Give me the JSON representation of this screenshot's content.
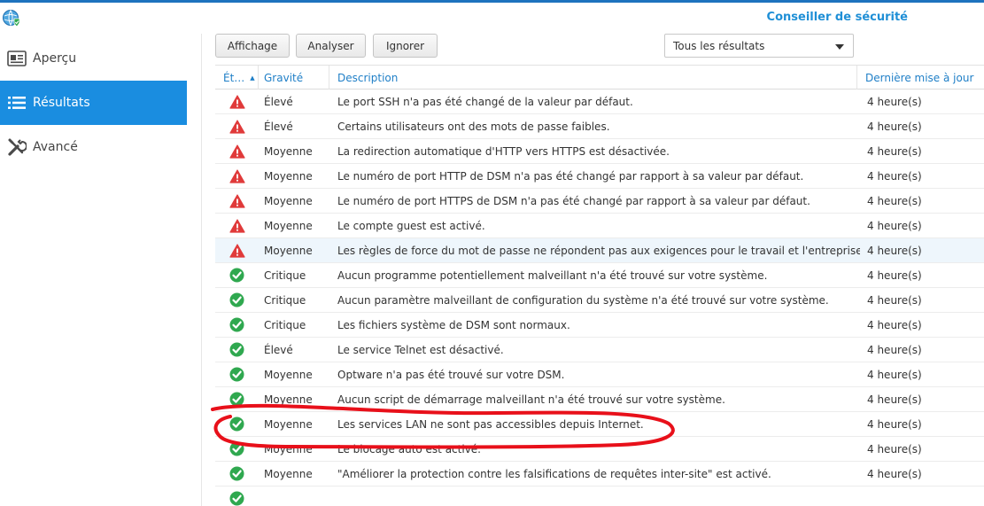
{
  "app": {
    "title": "Conseiller de sécurité",
    "icon": "security-globe-icon"
  },
  "sidebar": {
    "items": [
      {
        "label": "Aperçu",
        "icon": "overview-card-icon",
        "active": false
      },
      {
        "label": "Résultats",
        "icon": "list-icon",
        "active": true
      },
      {
        "label": "Avancé",
        "icon": "tools-icon",
        "active": false
      }
    ]
  },
  "toolbar": {
    "view_label": "Affichage",
    "analyze_label": "Analyser",
    "ignore_label": "Ignorer",
    "filter": {
      "selected": "Tous les résultats"
    }
  },
  "table": {
    "headers": {
      "status": "Ét…",
      "severity": "Gravité",
      "description": "Description",
      "updated": "Dernière mise à jour"
    },
    "rows": [
      {
        "status": "warning",
        "severity": "Élevé",
        "description": "Le port SSH n'a pas été changé de la valeur par défaut.",
        "updated": "4 heure(s)"
      },
      {
        "status": "warning",
        "severity": "Élevé",
        "description": "Certains utilisateurs ont des mots de passe faibles.",
        "updated": "4 heure(s)"
      },
      {
        "status": "warning",
        "severity": "Moyenne",
        "description": "La redirection automatique d'HTTP vers HTTPS est désactivée.",
        "updated": "4 heure(s)"
      },
      {
        "status": "warning",
        "severity": "Moyenne",
        "description": "Le numéro de port HTTP de DSM n'a pas été changé par rapport à sa valeur par défaut.",
        "updated": "4 heure(s)"
      },
      {
        "status": "warning",
        "severity": "Moyenne",
        "description": "Le numéro de port HTTPS de DSM n'a pas été changé par rapport à sa valeur par défaut.",
        "updated": "4 heure(s)"
      },
      {
        "status": "warning",
        "severity": "Moyenne",
        "description": "Le compte guest est activé.",
        "updated": "4 heure(s)"
      },
      {
        "status": "warning",
        "severity": "Moyenne",
        "description": "Les règles de force du mot de passe ne répondent pas aux exigences pour le travail et l'entreprise.",
        "updated": "4 heure(s)",
        "selected": true
      },
      {
        "status": "ok",
        "severity": "Critique",
        "description": "Aucun programme potentiellement malveillant n'a été trouvé sur votre système.",
        "updated": "4 heure(s)"
      },
      {
        "status": "ok",
        "severity": "Critique",
        "description": "Aucun paramètre malveillant de configuration du système n'a été trouvé sur votre système.",
        "updated": "4 heure(s)"
      },
      {
        "status": "ok",
        "severity": "Critique",
        "description": "Les fichiers système de DSM sont normaux.",
        "updated": "4 heure(s)"
      },
      {
        "status": "ok",
        "severity": "Élevé",
        "description": "Le service Telnet est désactivé.",
        "updated": "4 heure(s)"
      },
      {
        "status": "ok",
        "severity": "Moyenne",
        "description": "Optware n'a pas été trouvé sur votre DSM.",
        "updated": "4 heure(s)"
      },
      {
        "status": "ok",
        "severity": "Moyenne",
        "description": "Aucun script de démarrage malveillant n'a été trouvé sur votre système.",
        "updated": "4 heure(s)"
      },
      {
        "status": "ok",
        "severity": "Moyenne",
        "description": "Les services LAN ne sont pas accessibles depuis Internet.",
        "updated": "4 heure(s)"
      },
      {
        "status": "ok",
        "severity": "Moyenne",
        "description": "Le blocage auto est activé.",
        "updated": "4 heure(s)"
      },
      {
        "status": "ok",
        "severity": "Moyenne",
        "description": "\"Améliorer la protection contre les falsifications de requêtes inter-site\" est activé.",
        "updated": "4 heure(s)"
      },
      {
        "status": "ok",
        "severity": "",
        "description": "",
        "updated": ""
      }
    ]
  },
  "colors": {
    "accent": "#1a8de0",
    "warning": "#e03a3a",
    "ok": "#2fa84f",
    "annotation": "#e8101a"
  }
}
